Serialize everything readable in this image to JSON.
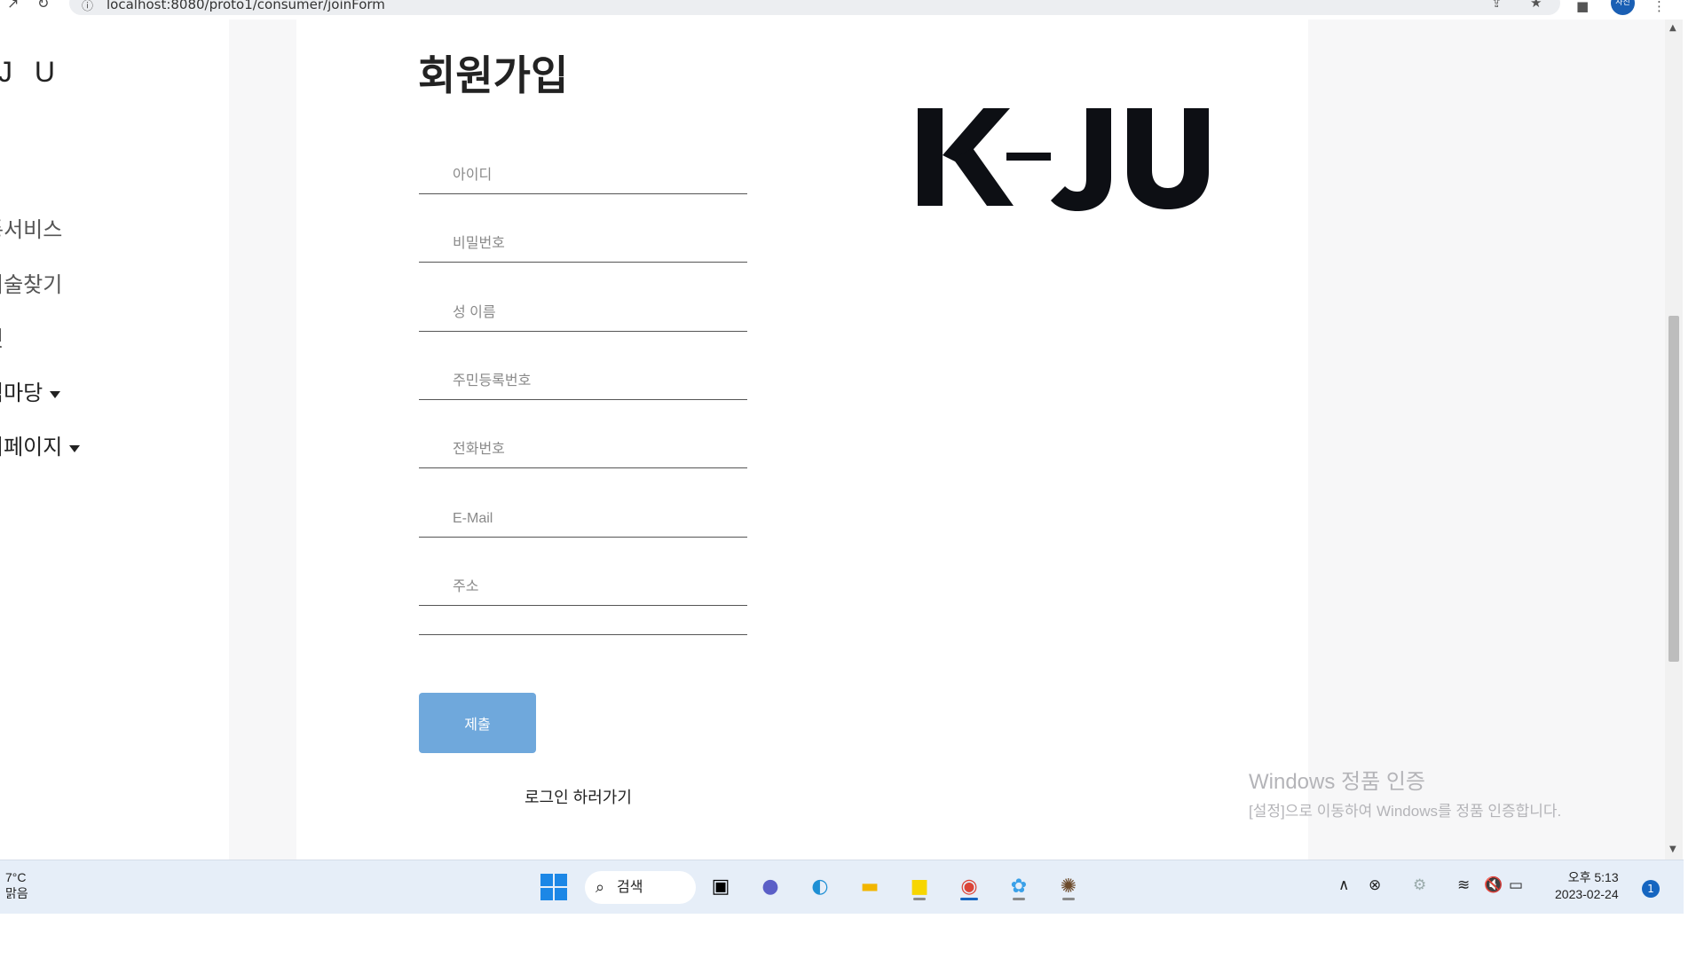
{
  "browser": {
    "url": "localhost:8080/proto1/consumer/joinForm",
    "profile_initials": "사진"
  },
  "sidebar": {
    "brand": "J U",
    "items": [
      {
        "label": "통서비스"
      },
      {
        "label": "기술찾기"
      },
      {
        "label": "빗"
      },
      {
        "label": "넉마당"
      },
      {
        "label": "이페이지"
      }
    ]
  },
  "form": {
    "title": "회원가입",
    "fields": [
      {
        "placeholder": "아이디"
      },
      {
        "placeholder": "비밀번호"
      },
      {
        "placeholder": "성 이름"
      },
      {
        "placeholder": "주민등록번호"
      },
      {
        "placeholder": "전화번호"
      },
      {
        "placeholder": "E-Mail"
      },
      {
        "placeholder": "주소"
      }
    ],
    "submit_label": "제출",
    "login_link": "로그인 하러가기"
  },
  "logo": {
    "text": "K-JU"
  },
  "watermark": {
    "title": "Windows 정품 인증",
    "subtitle": "[설정]으로 이동하여 Windows를 정품 인증합니다."
  },
  "taskbar": {
    "weather_temp": "7°C",
    "weather_cond": "맑음",
    "search_label": "검색",
    "time": "오후 5:13",
    "date": "2023-02-24",
    "notification_count": "1"
  },
  "colors": {
    "submit": "#6fa8dc",
    "page_bg": "#f7f7f8",
    "accent": "#1565c0"
  }
}
